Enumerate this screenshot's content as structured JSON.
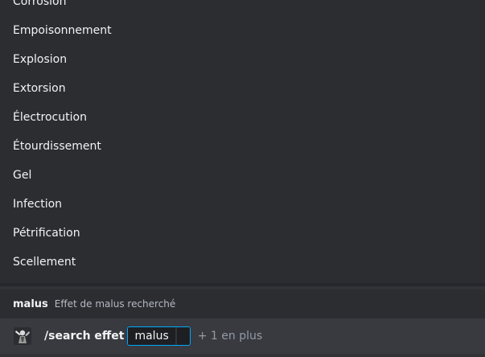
{
  "autocomplete": {
    "options": [
      "Corrosion",
      "Empoisonnement",
      "Explosion",
      "Extorsion",
      "Électrocution",
      "Étourdissement",
      "Gel",
      "Infection",
      "Pétrification",
      "Scellement"
    ]
  },
  "param_hint": {
    "name": "malus",
    "description": "Effet de malus recherché"
  },
  "command_bar": {
    "avatar_icon": "bot-avatar-icon",
    "command": "/search effet",
    "option_value": "malus",
    "more_options": "+ 1 en plus"
  },
  "colors": {
    "background": "#313338",
    "popup_background": "#2b2d31",
    "command_bar_background": "#383a40",
    "focus_border": "#00a8fc",
    "text_primary": "#f2f3f5",
    "text_muted": "#949ba4"
  }
}
